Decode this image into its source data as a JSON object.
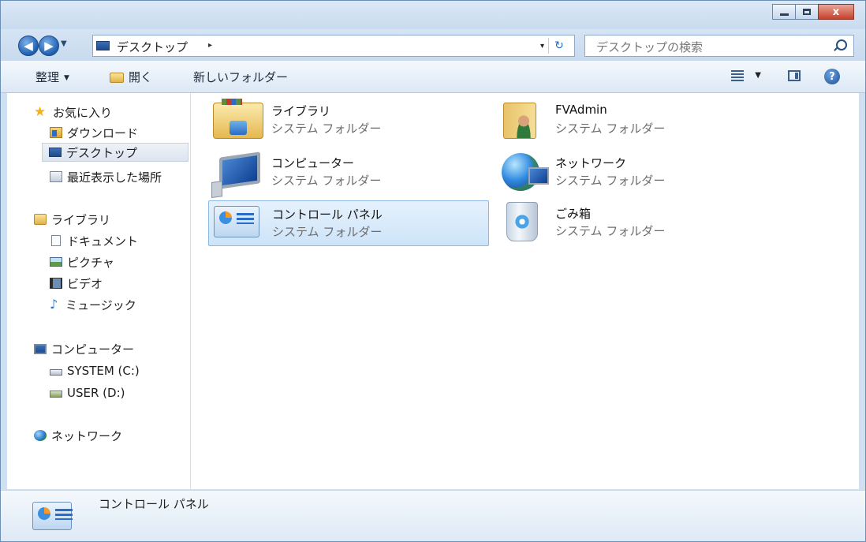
{
  "window": {
    "minimize_icon": "minimize-icon",
    "maximize_icon": "maximize-icon",
    "close_label": "x"
  },
  "address_bar": {
    "location": "デスクトップ",
    "separator": "▸",
    "dropdown": "▾",
    "refresh_icon": "refresh-icon"
  },
  "search": {
    "placeholder": "デスクトップの検索"
  },
  "toolbar": {
    "organize_label": "整理",
    "open_label": "開く",
    "new_folder_label": "新しいフォルダー"
  },
  "sidebar": {
    "favorites": {
      "label": "お気に入り",
      "items": [
        {
          "label": "ダウンロード"
        },
        {
          "label": "デスクトップ"
        },
        {
          "label": "最近表示した場所"
        }
      ]
    },
    "libraries": {
      "label": "ライブラリ",
      "items": [
        {
          "label": "ドキュメント"
        },
        {
          "label": "ピクチャ"
        },
        {
          "label": "ビデオ"
        },
        {
          "label": "ミュージック"
        }
      ]
    },
    "computer": {
      "label": "コンピューター",
      "items": [
        {
          "label": "SYSTEM (C:)"
        },
        {
          "label": "USER (D:)"
        }
      ]
    },
    "network": {
      "label": "ネットワーク"
    }
  },
  "content": {
    "items": [
      {
        "name": "ライブラリ",
        "type": "システム フォルダー"
      },
      {
        "name": "FVAdmin",
        "type": "システム フォルダー"
      },
      {
        "name": "コンピューター",
        "type": "システム フォルダー"
      },
      {
        "name": "ネットワーク",
        "type": "システム フォルダー"
      },
      {
        "name": "コントロール パネル",
        "type": "システム フォルダー"
      },
      {
        "name": "ごみ箱",
        "type": "システム フォルダー"
      }
    ]
  },
  "details": {
    "name": "コントロール パネル"
  },
  "colors": {
    "frame": "#cfe0f2",
    "selection": "#cde4f9",
    "accent": "#1f5fae"
  }
}
